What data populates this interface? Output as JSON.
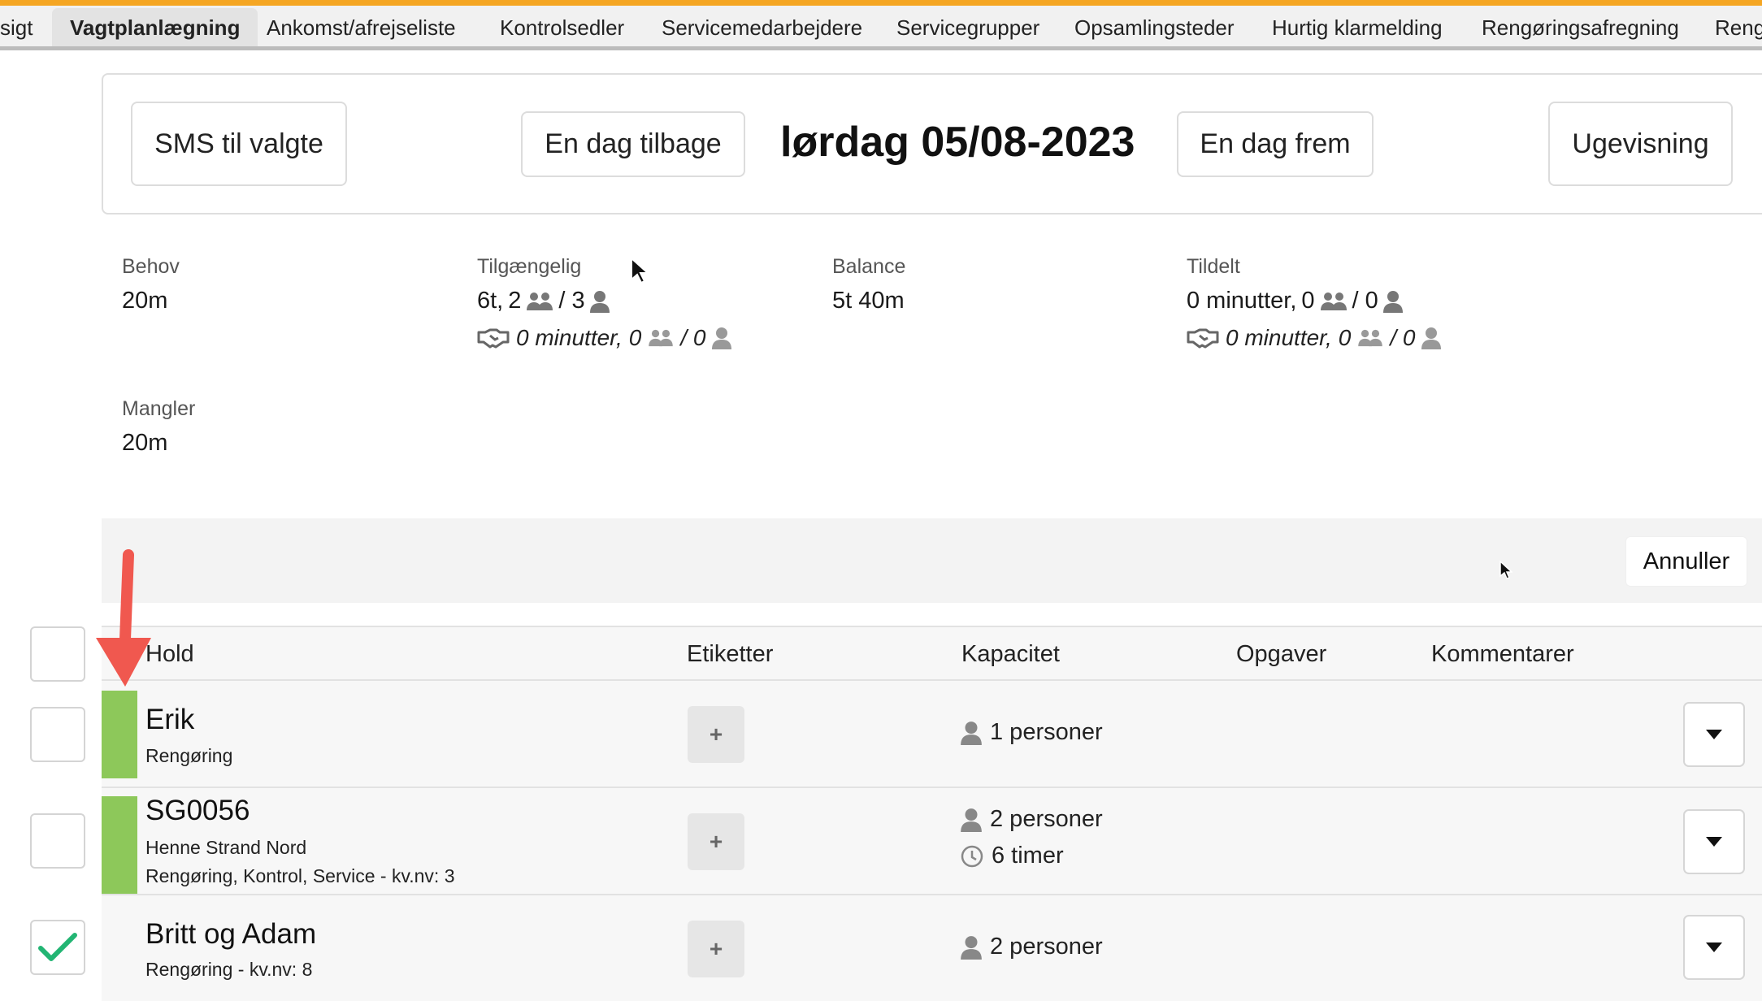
{
  "nav": {
    "tabs": [
      {
        "label": "sigt"
      },
      {
        "label": "Vagtplanlægning"
      },
      {
        "label": "Ankomst/afrejseliste"
      },
      {
        "label": "Kontrolsedler"
      },
      {
        "label": "Servicemedarbejdere"
      },
      {
        "label": "Servicegrupper"
      },
      {
        "label": "Opsamlingsteder"
      },
      {
        "label": "Hurtig klarmelding"
      },
      {
        "label": "Rengøringsafregning"
      },
      {
        "label": "Reng"
      }
    ],
    "active": "Vagtplanlægning"
  },
  "datebar": {
    "sms_label": "SMS til valgte",
    "prev_label": "En dag tilbage",
    "date": "lørdag 05/08-2023",
    "next_label": "En dag frem",
    "week_label": "Ugevisning"
  },
  "stats": {
    "behov": {
      "label": "Behov",
      "value": "20m"
    },
    "tilgaengelig": {
      "label": "Tilgængelig",
      "time": "6t,",
      "groups": "2",
      "persons": "/ 3",
      "sub_time": "0 minutter,",
      "sub_groups": "0",
      "sub_persons": "/ 0"
    },
    "balance": {
      "label": "Balance",
      "value": "5t 40m"
    },
    "tildelt": {
      "label": "Tildelt",
      "time": "0 minutter,",
      "groups": "0",
      "persons": "/ 0",
      "sub_time": "0 minutter,",
      "sub_groups": "0",
      "sub_persons": "/ 0"
    },
    "mangler": {
      "label": "Mangler",
      "value": "20m"
    }
  },
  "actions": {
    "cancel_label": "Annuller"
  },
  "table": {
    "headers": {
      "hold": "Hold",
      "etiketter": "Etiketter",
      "kapacitet": "Kapacitet",
      "opgaver": "Opgaver",
      "kommentarer": "Kommentarer"
    },
    "rows": [
      {
        "title": "Erik",
        "sub1": "Rengøring",
        "sub2": "",
        "capacity": "1 personer",
        "hours": "",
        "checked": false,
        "color": "#8dc85a"
      },
      {
        "title": "SG0056",
        "sub1": "Henne Strand Nord",
        "sub2": "Rengøring, Kontrol, Service - kv.nv: 3",
        "capacity": "2 personer",
        "hours": "6 timer",
        "checked": false,
        "color": "#8dc85a"
      },
      {
        "title": "Britt og Adam",
        "sub1": "Rengøring - kv.nv: 8",
        "sub2": "",
        "capacity": "2 personer",
        "hours": "",
        "checked": true,
        "color": ""
      }
    ],
    "plus_label": "+"
  },
  "colors": {
    "accent_top": "#f5a623",
    "group_color": "#8dc85a",
    "check_color": "#22b573",
    "arrow_color": "#f0584f"
  },
  "icons": {
    "group": "people-icon",
    "person": "person-icon",
    "handshake": "handshake-icon",
    "clock": "clock-icon",
    "caret": "caret-down-icon",
    "check": "check-icon",
    "arrow": "red-arrow-annotation"
  }
}
